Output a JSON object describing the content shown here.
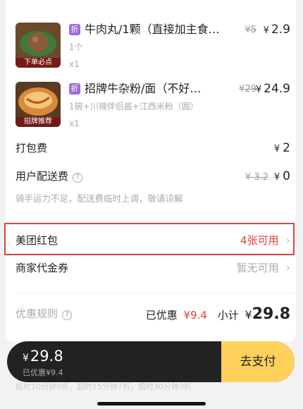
{
  "items": [
    {
      "name": "牛肉丸/1颗（直接加主食…",
      "discount_badge": "折",
      "old_price": "¥5",
      "currency": "¥",
      "price": "2.9",
      "spec": "1个",
      "qty": "x1",
      "image_tag": "下单必点"
    },
    {
      "name": "招牌牛杂粉/面（不好…",
      "discount_badge": "折",
      "old_price": "¥29",
      "currency": "¥",
      "price": "24.9",
      "spec": "1碗+川辣伴侣酱+江西米粉（圆）",
      "qty": "x1",
      "image_tag": "招牌推荐"
    }
  ],
  "packing": {
    "label": "打包费",
    "currency": "¥",
    "value": "2"
  },
  "delivery": {
    "label": "用户配送费",
    "help_icon": "?",
    "old": "¥ 3.2",
    "currency": "¥",
    "value": "0",
    "note": "骑手运力不足，配送费临时上调，敬请谅解"
  },
  "red_packet": {
    "label": "美团红包",
    "value": "4张可用",
    "arrow": "›"
  },
  "voucher": {
    "label": "商家代金券",
    "value": "暂无可用",
    "arrow": "›"
  },
  "summary": {
    "rules_label": "优惠规则",
    "help_icon": "?",
    "saved_label": "已优惠",
    "saved_value": "¥9.4",
    "subtotal_label": "小计",
    "currency": "¥",
    "subtotal": "29.8"
  },
  "checkout": {
    "currency": "¥",
    "amount": "29.8",
    "saved_text": "已优惠¥9.4",
    "pay_label": "去支付",
    "underlay_text": "超时10分钟9折，超时15分钟7折，超时30分钟3折"
  },
  "colors": {
    "accent_red": "#e0403f",
    "pay_yellow": "#ffd15b",
    "badge_purple": "#9b6bdb"
  }
}
